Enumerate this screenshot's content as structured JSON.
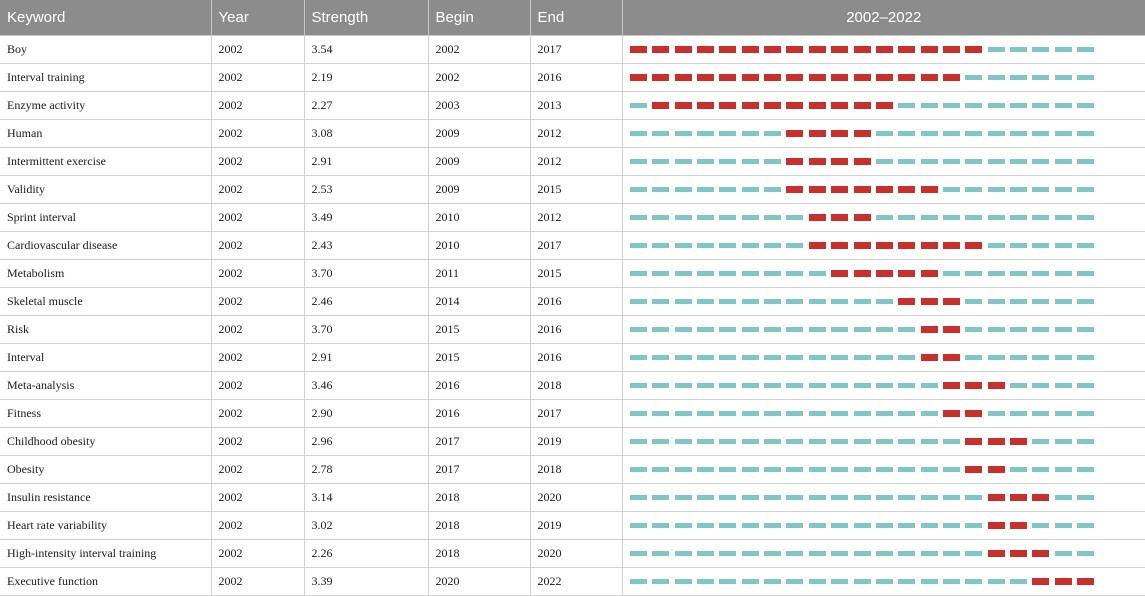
{
  "colors": {
    "header_bg": "#8c8c8c",
    "burst": "#c8302c",
    "baseline": "#80c6c6"
  },
  "header": {
    "keyword": "Keyword",
    "year": "Year",
    "strength": "Strength",
    "begin": "Begin",
    "end": "End",
    "timeline": "2002–2022"
  },
  "timeline_range": {
    "start": 2002,
    "end": 2022
  },
  "rows": [
    {
      "keyword": "Boy",
      "year": "2002",
      "strength": "3.54",
      "begin": "2002",
      "end": "2017"
    },
    {
      "keyword": "Interval training",
      "year": "2002",
      "strength": "2.19",
      "begin": "2002",
      "end": "2016"
    },
    {
      "keyword": "Enzyme activity",
      "year": "2002",
      "strength": "2.27",
      "begin": "2003",
      "end": "2013"
    },
    {
      "keyword": "Human",
      "year": "2002",
      "strength": "3.08",
      "begin": "2009",
      "end": "2012"
    },
    {
      "keyword": "Intermittent exercise",
      "year": "2002",
      "strength": "2.91",
      "begin": "2009",
      "end": "2012"
    },
    {
      "keyword": "Validity",
      "year": "2002",
      "strength": "2.53",
      "begin": "2009",
      "end": "2015"
    },
    {
      "keyword": "Sprint interval",
      "year": "2002",
      "strength": "3.49",
      "begin": "2010",
      "end": "2012"
    },
    {
      "keyword": "Cardiovascular disease",
      "year": "2002",
      "strength": "2.43",
      "begin": "2010",
      "end": "2017"
    },
    {
      "keyword": "Metabolism",
      "year": "2002",
      "strength": "3.70",
      "begin": "2011",
      "end": "2015"
    },
    {
      "keyword": "Skeletal muscle",
      "year": "2002",
      "strength": "2.46",
      "begin": "2014",
      "end": "2016"
    },
    {
      "keyword": "Risk",
      "year": "2002",
      "strength": "3.70",
      "begin": "2015",
      "end": "2016"
    },
    {
      "keyword": "Interval",
      "year": "2002",
      "strength": "2.91",
      "begin": "2015",
      "end": "2016"
    },
    {
      "keyword": "Meta-analysis",
      "year": "2002",
      "strength": "3.46",
      "begin": "2016",
      "end": "2018"
    },
    {
      "keyword": "Fitness",
      "year": "2002",
      "strength": "2.90",
      "begin": "2016",
      "end": "2017"
    },
    {
      "keyword": "Childhood obesity",
      "year": "2002",
      "strength": "2.96",
      "begin": "2017",
      "end": "2019"
    },
    {
      "keyword": "Obesity",
      "year": "2002",
      "strength": "2.78",
      "begin": "2017",
      "end": "2018"
    },
    {
      "keyword": "Insulin resistance",
      "year": "2002",
      "strength": "3.14",
      "begin": "2018",
      "end": "2020"
    },
    {
      "keyword": "Heart rate variability",
      "year": "2002",
      "strength": "3.02",
      "begin": "2018",
      "end": "2019"
    },
    {
      "keyword": "High-intensity interval training",
      "year": "2002",
      "strength": "2.26",
      "begin": "2018",
      "end": "2020"
    },
    {
      "keyword": "Executive function",
      "year": "2002",
      "strength": "3.39",
      "begin": "2020",
      "end": "2022"
    }
  ]
}
